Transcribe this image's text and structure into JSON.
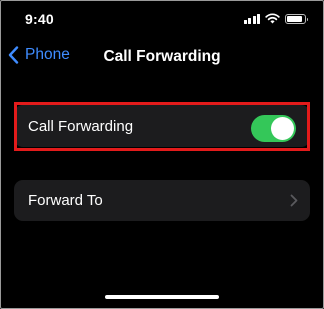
{
  "status_bar": {
    "time": "9:40",
    "signal_icon": "signal-icon",
    "wifi_icon": "wifi-icon",
    "battery_icon": "battery-icon"
  },
  "nav": {
    "back_label": "Phone",
    "title": "Call Forwarding"
  },
  "settings": {
    "call_forwarding": {
      "label": "Call Forwarding",
      "enabled": true
    },
    "forward_to": {
      "label": "Forward To"
    }
  },
  "colors": {
    "accent": "#3f8cff",
    "toggle_on": "#34c759",
    "highlight": "#e31b1b",
    "cell_bg": "#1c1c1e"
  }
}
